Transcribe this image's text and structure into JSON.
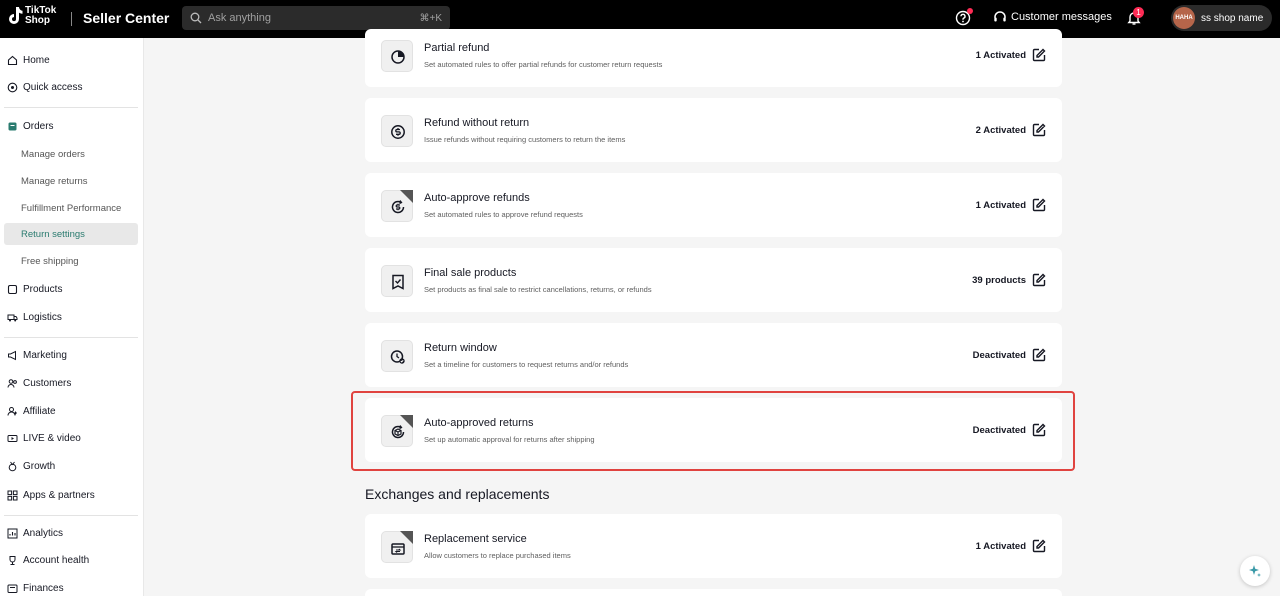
{
  "topbar": {
    "logo_line1": "TikTok",
    "logo_line2": "Shop",
    "app_name": "Seller Center",
    "search_placeholder": "Ask anything",
    "search_shortcut": "⌘+K",
    "customer_messages": "Customer messages",
    "notification_count": "1",
    "avatar_text": "HAHA",
    "shop_name": "ss shop name"
  },
  "sidebar": {
    "home": "Home",
    "quick_access": "Quick access",
    "orders": "Orders",
    "manage_orders": "Manage orders",
    "manage_returns": "Manage returns",
    "fulfillment_performance": "Fulfillment Performance",
    "return_settings": "Return settings",
    "free_shipping": "Free shipping",
    "products": "Products",
    "logistics": "Logistics",
    "marketing": "Marketing",
    "customers": "Customers",
    "affiliate": "Affiliate",
    "live_video": "LIVE & video",
    "growth": "Growth",
    "apps_partners": "Apps & partners",
    "analytics": "Analytics",
    "account_health": "Account health",
    "finances": "Finances"
  },
  "cards": [
    {
      "title": "Partial refund",
      "desc": "Set automated rules to offer partial refunds for customer return requests",
      "status": "1 Activated",
      "icon": "pie-chart-icon"
    },
    {
      "title": "Refund without return",
      "desc": "Issue refunds without requiring customers to return the items",
      "status": "2 Activated",
      "icon": "dollar-circle-icon"
    },
    {
      "title": "Auto-approve refunds",
      "desc": "Set automated rules to approve refund requests",
      "status": "1 Activated",
      "icon": "dollar-cycle-icon"
    },
    {
      "title": "Final sale products",
      "desc": "Set products as final sale to restrict cancellations, returns, or refunds",
      "status": "39 products",
      "icon": "tag-check-icon"
    },
    {
      "title": "Return window",
      "desc": "Set a timeline for customers to request returns and/or refunds",
      "status": "Deactivated",
      "icon": "clock-icon"
    },
    {
      "title": "Auto-approved returns",
      "desc": "Set up automatic approval for returns after shipping",
      "status": "Deactivated",
      "icon": "box-cycle-icon"
    },
    {
      "title": "Replacement service",
      "desc": "Allow customers to replace purchased items",
      "status": "1 Activated",
      "icon": "box-swap-icon"
    }
  ],
  "sections": {
    "exchanges_heading": "Exchanges and replacements"
  },
  "colors": {
    "highlight": "#e0433f",
    "active_nav_text": "#2a7b6f",
    "badge": "#fe2c55"
  }
}
